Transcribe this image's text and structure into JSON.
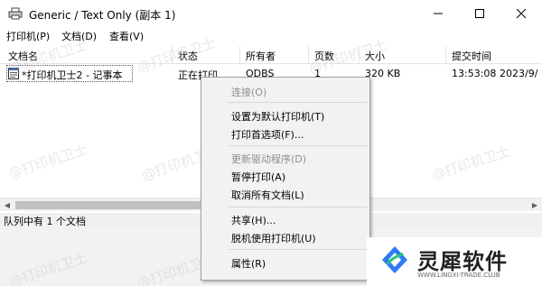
{
  "window": {
    "title": "Generic / Text Only (副本 1)"
  },
  "menubar": {
    "items": [
      {
        "label": "打印机(P)"
      },
      {
        "label": "文档(D)"
      },
      {
        "label": "查看(V)"
      }
    ]
  },
  "columns": [
    "文档名",
    "状态",
    "所有者",
    "页数",
    "大小",
    "提交时间"
  ],
  "rows": [
    {
      "name": "*打印机卫士2 - 记事本",
      "status": "正在打印",
      "owner": "ODBS",
      "pages": "1",
      "size": "320 KB",
      "time": "13:53:08",
      "date": "2023/9/"
    }
  ],
  "statusbar": {
    "text": "队列中有 1 个文档"
  },
  "context_menu": {
    "items": [
      {
        "label": "连接(O)",
        "enabled": false
      },
      {
        "label": "设置为默认打印机(T)",
        "enabled": true
      },
      {
        "label": "打印首选项(F)...",
        "enabled": true
      },
      {
        "label": "更新驱动程序(D)",
        "enabled": false
      },
      {
        "label": "暂停打印(A)",
        "enabled": true
      },
      {
        "label": "取消所有文档(L)",
        "enabled": true
      },
      {
        "label": "共享(H)...",
        "enabled": true
      },
      {
        "label": "脱机使用打印机(U)",
        "enabled": true
      },
      {
        "label": "属性(R)",
        "enabled": true
      }
    ]
  },
  "watermark": {
    "text": "@打印机卫士"
  },
  "logo": {
    "brand": "灵犀软件",
    "url": "WWW.LINGXI-TRADE.CLUB"
  },
  "colors": {
    "logo_blue": "#2f7bf6",
    "logo_green": "#29c57a",
    "disabled_text": "#8d8d8d"
  }
}
